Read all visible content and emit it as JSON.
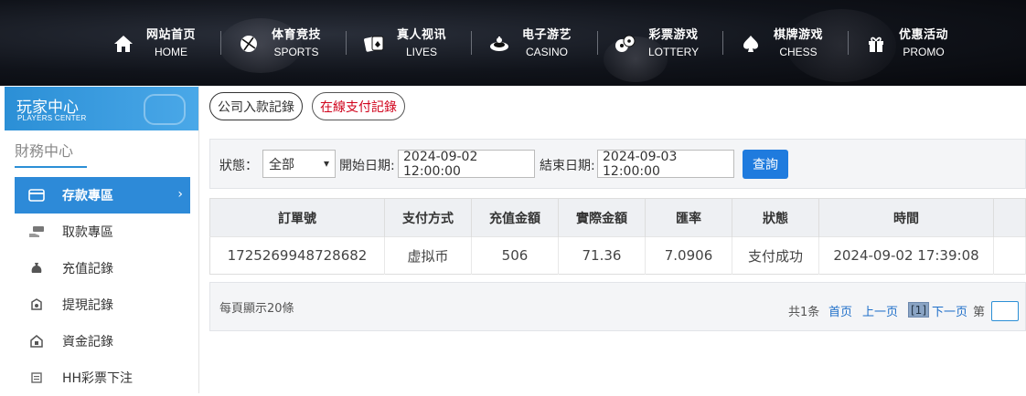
{
  "nav": {
    "items": [
      {
        "cn": "网站首页",
        "en": "HOME",
        "icon": "home-icon"
      },
      {
        "cn": "体育竞技",
        "en": "SPORTS",
        "icon": "basketball-icon"
      },
      {
        "cn": "真人视讯",
        "en": "LIVES",
        "icon": "playing-cards-icon"
      },
      {
        "cn": "电子游艺",
        "en": "CASINO",
        "icon": "slot-machine-icon"
      },
      {
        "cn": "彩票游戏",
        "en": "LOTTERY",
        "icon": "lottery-balls-icon"
      },
      {
        "cn": "棋牌游戏",
        "en": "CHESS",
        "icon": "spade-icon"
      },
      {
        "cn": "优惠活动",
        "en": "PROMO",
        "icon": "gift-icon"
      }
    ]
  },
  "sidebar": {
    "title": "玩家中心",
    "subtitle": "PLAYERS CENTER",
    "section": "財務中心",
    "items": [
      {
        "label": "存款專區",
        "icon": "wallet-card-icon",
        "active": true
      },
      {
        "label": "取款專區",
        "icon": "cash-hand-icon",
        "active": false
      },
      {
        "label": "充值記錄",
        "icon": "money-bag-icon",
        "active": false
      },
      {
        "label": "提現記錄",
        "icon": "withdraw-icon",
        "active": false
      },
      {
        "label": "資金記錄",
        "icon": "fund-icon",
        "active": false
      },
      {
        "label": "HH彩票下注",
        "icon": "list-icon",
        "active": false
      }
    ]
  },
  "tabs": {
    "company": "公司入款記錄",
    "online": "在線支付記錄"
  },
  "filter": {
    "status_label": "狀態：",
    "status_value": "全部",
    "start_label": "開始日期:",
    "start_value": "2024-09-02 12:00:00",
    "end_label": "結束日期:",
    "end_value": "2024-09-03 12:00:00",
    "query": "查詢"
  },
  "table": {
    "headers": [
      "訂單號",
      "支付方式",
      "充值金額",
      "實際金額",
      "匯率",
      "狀態",
      "時間"
    ],
    "rows": [
      [
        "1725269948728682",
        "虚拟币",
        "506",
        "71.36",
        "7.0906",
        "支付成功",
        "2024-09-02 17:39:08"
      ]
    ]
  },
  "pager": {
    "per_page": "每頁顯示20條",
    "total": "共1条",
    "first": "首页",
    "prev": "上一页",
    "current": "[1]",
    "next": "下一页",
    "goto": "第"
  },
  "colors": {
    "accent": "#2d8ad8",
    "button": "#1f7bde",
    "active_tab_text": "#d0021b"
  }
}
